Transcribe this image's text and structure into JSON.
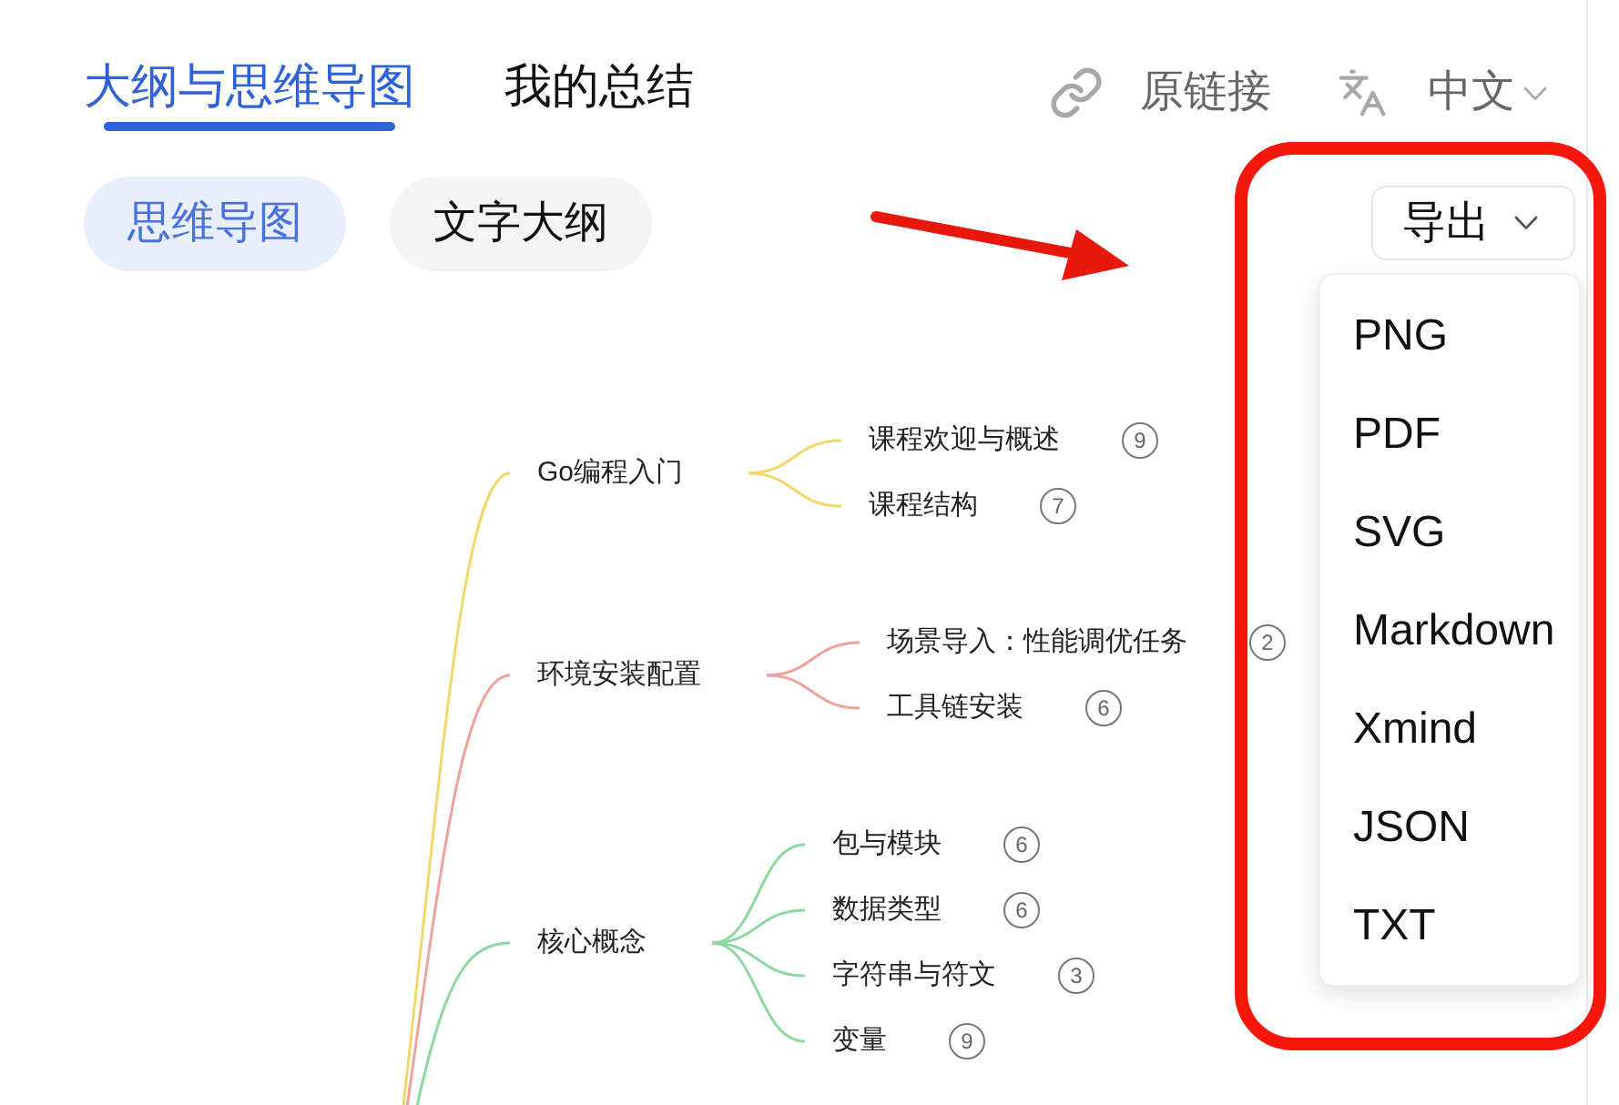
{
  "header": {
    "tabs": [
      {
        "label": "大纲与思维导图",
        "selected": true
      },
      {
        "label": "我的总结",
        "selected": false
      }
    ],
    "source_link": "原链接",
    "language": "中文"
  },
  "view_tabs": [
    {
      "label": "思维导图",
      "selected": true
    },
    {
      "label": "文字大纲",
      "selected": false
    }
  ],
  "export": {
    "label": "导出",
    "expanded": true,
    "options": [
      "PNG",
      "PDF",
      "SVG",
      "Markdown",
      "Xmind",
      "JSON",
      "TXT"
    ]
  },
  "mind_map": {
    "branches": [
      {
        "title": "Go编程入门",
        "color": "#f2d76b",
        "children": [
          {
            "title": "课程欢迎与概述",
            "count": "9"
          },
          {
            "title": "课程结构",
            "count": "7"
          }
        ]
      },
      {
        "title": "环境安装配置",
        "color": "#eda39b",
        "children": [
          {
            "title": "场景导入：性能调优任务",
            "count": "2"
          },
          {
            "title": "工具链安装",
            "count": "6"
          }
        ]
      },
      {
        "title": "核心概念",
        "color": "#8ed8a0",
        "children": [
          {
            "title": "包与模块",
            "count": "6"
          },
          {
            "title": "数据类型",
            "count": "6"
          },
          {
            "title": "字符串与符文",
            "count": "3"
          },
          {
            "title": "变量",
            "count": "9"
          }
        ]
      }
    ]
  }
}
